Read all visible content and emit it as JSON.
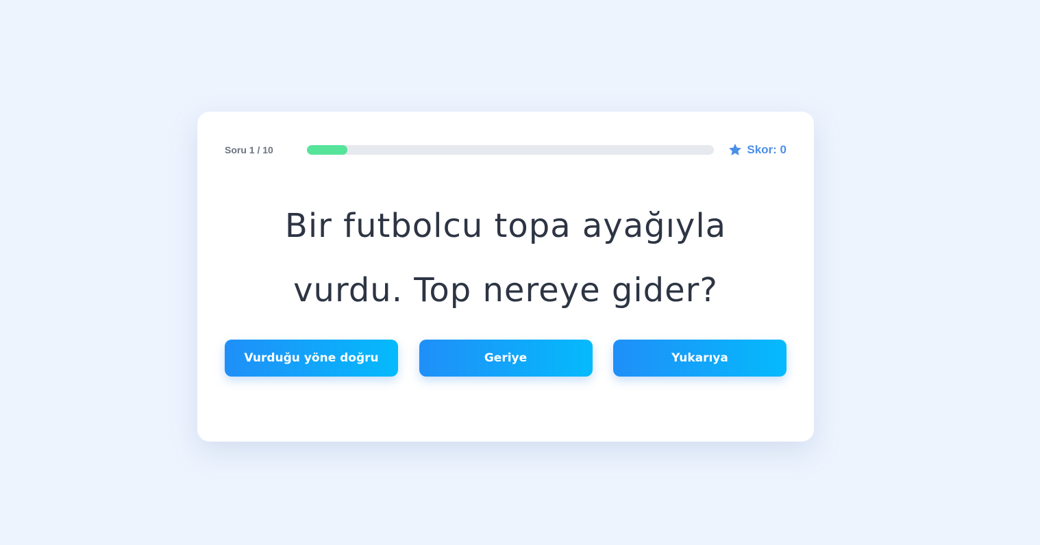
{
  "quiz": {
    "counter": "Soru 1 / 10",
    "progress": 0.1,
    "score_label": "Skor: 0",
    "score_icon": "star-icon",
    "question": "Bir futbolcu topa ayağıyla vurdu. Top nereye gider?",
    "answers": [
      {
        "label": "Vurduğu yöne doğru"
      },
      {
        "label": "Geriye"
      },
      {
        "label": "Yukarıya"
      }
    ]
  },
  "colors": {
    "background": "#edf4fe",
    "progress_fill": "#56e39a",
    "accent": "#4b8fe8",
    "button_gradient_start": "#1f8ff8",
    "button_gradient_end": "#05bafc"
  }
}
